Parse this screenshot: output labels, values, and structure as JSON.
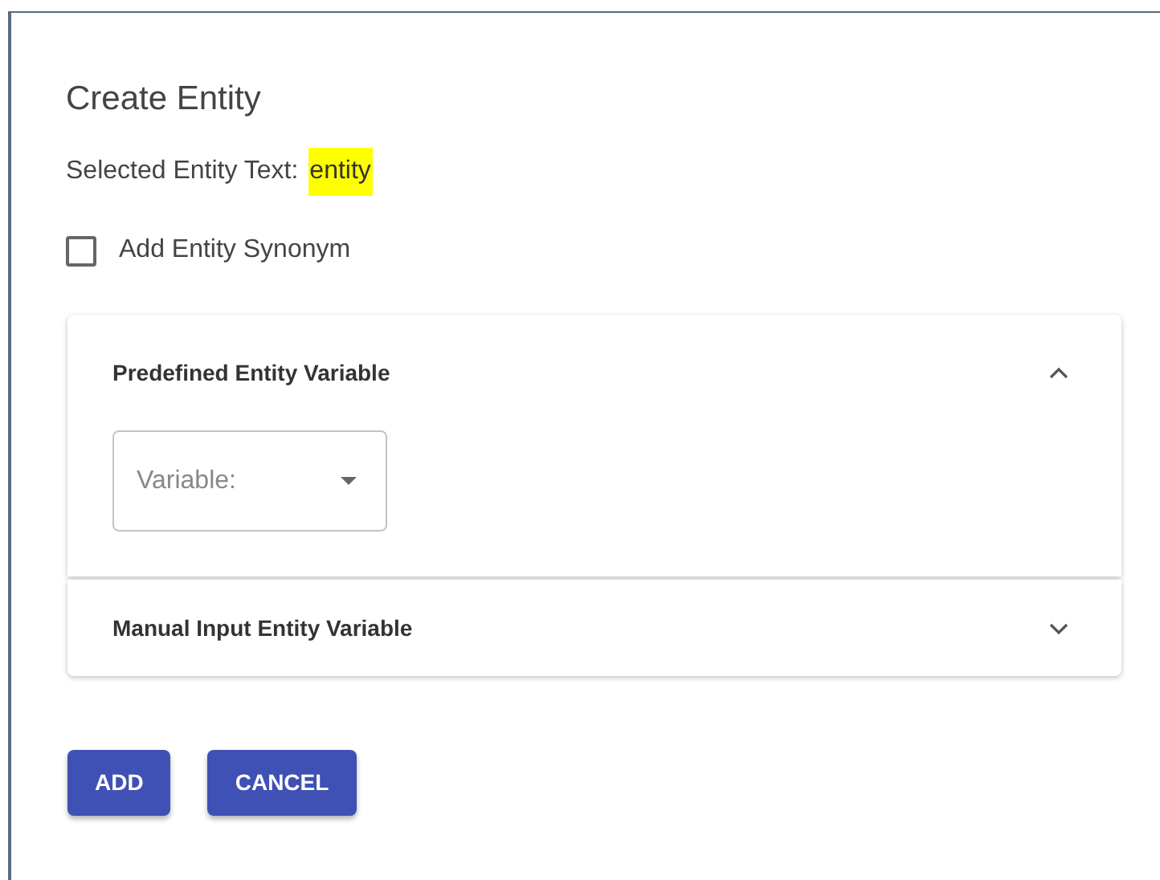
{
  "dialog": {
    "title": "Create Entity",
    "selected_label": "Selected Entity Text:",
    "selected_value": "entity"
  },
  "synonym_checkbox": {
    "label": "Add Entity Synonym",
    "checked": false
  },
  "panels": [
    {
      "title": "Predefined Entity Variable",
      "expanded": true,
      "select": {
        "placeholder": "Variable:"
      }
    },
    {
      "title": "Manual Input Entity Variable",
      "expanded": false
    }
  ],
  "buttons": [
    "ADD",
    "CANCEL"
  ]
}
